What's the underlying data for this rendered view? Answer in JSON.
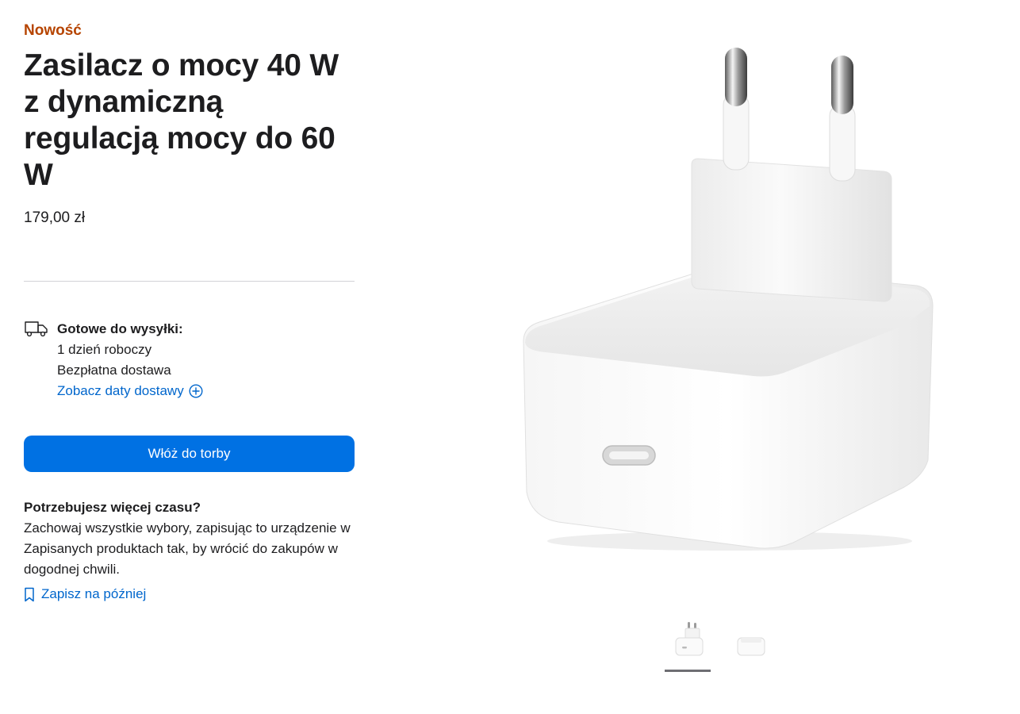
{
  "product": {
    "badge": "Nowość",
    "title": "Zasilacz o mocy 40 W z dynamiczną regulacją mocy do 60 W",
    "price": "179,00 zł"
  },
  "shipping": {
    "heading": "Gotowe do wysyłki:",
    "time": "1 dzień roboczy",
    "cost": "Bezpłatna dostawa",
    "link": "Zobacz daty dostawy",
    "icon": "truck-icon"
  },
  "cta": {
    "label": "Włóż do torby"
  },
  "save": {
    "heading": "Potrzebujesz więcej czasu?",
    "body": "Zachowaj wszystkie wybory, zapisując to urządzenie w Zapisanych produktach tak, by wrócić do zakupów w dogodnej chwili.",
    "link": "Zapisz na później",
    "icon": "bookmark-icon"
  },
  "gallery": {
    "selected_index": 0,
    "thumbnails": [
      "charger-front-thumbnail",
      "charger-side-thumbnail"
    ]
  },
  "colors": {
    "accent": "#0071e3",
    "link": "#0066cc",
    "badge": "#b64400",
    "text": "#1d1d1f"
  }
}
